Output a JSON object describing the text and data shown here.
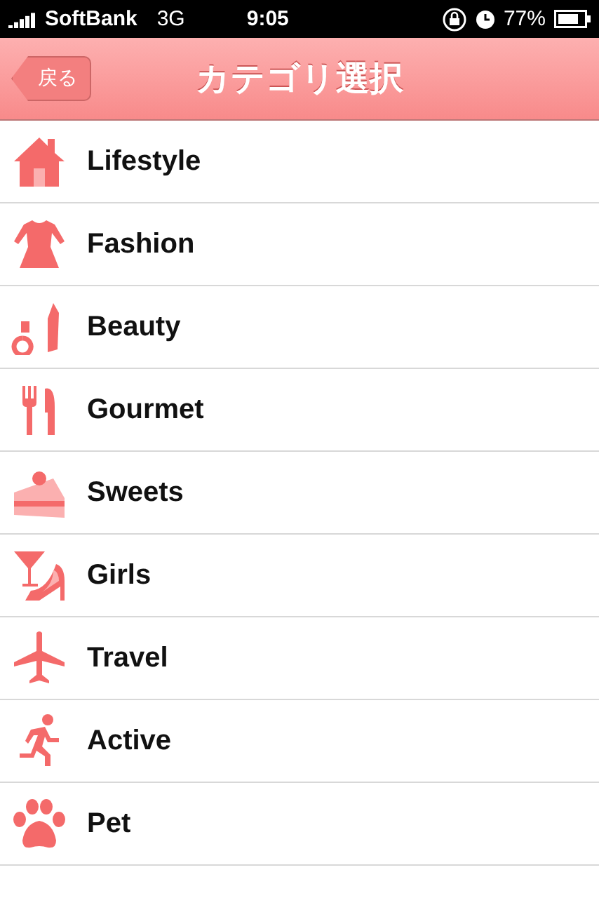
{
  "status_bar": {
    "carrier": "SoftBank",
    "network": "3G",
    "time": "9:05",
    "battery": "77%"
  },
  "nav_bar": {
    "back": "戻る",
    "title": "カテゴリ選択"
  },
  "categories": [
    {
      "label": "Lifestyle",
      "kind": "house"
    },
    {
      "label": "Fashion",
      "kind": "dress"
    },
    {
      "label": "Beauty",
      "kind": "cosmetics"
    },
    {
      "label": "Gourmet",
      "kind": "cutlery"
    },
    {
      "label": "Sweets",
      "kind": "cake"
    },
    {
      "label": "Girls",
      "kind": "cocktail"
    },
    {
      "label": "Travel",
      "kind": "plane"
    },
    {
      "label": "Active",
      "kind": "runner"
    },
    {
      "label": "Pet",
      "kind": "paw"
    }
  ]
}
